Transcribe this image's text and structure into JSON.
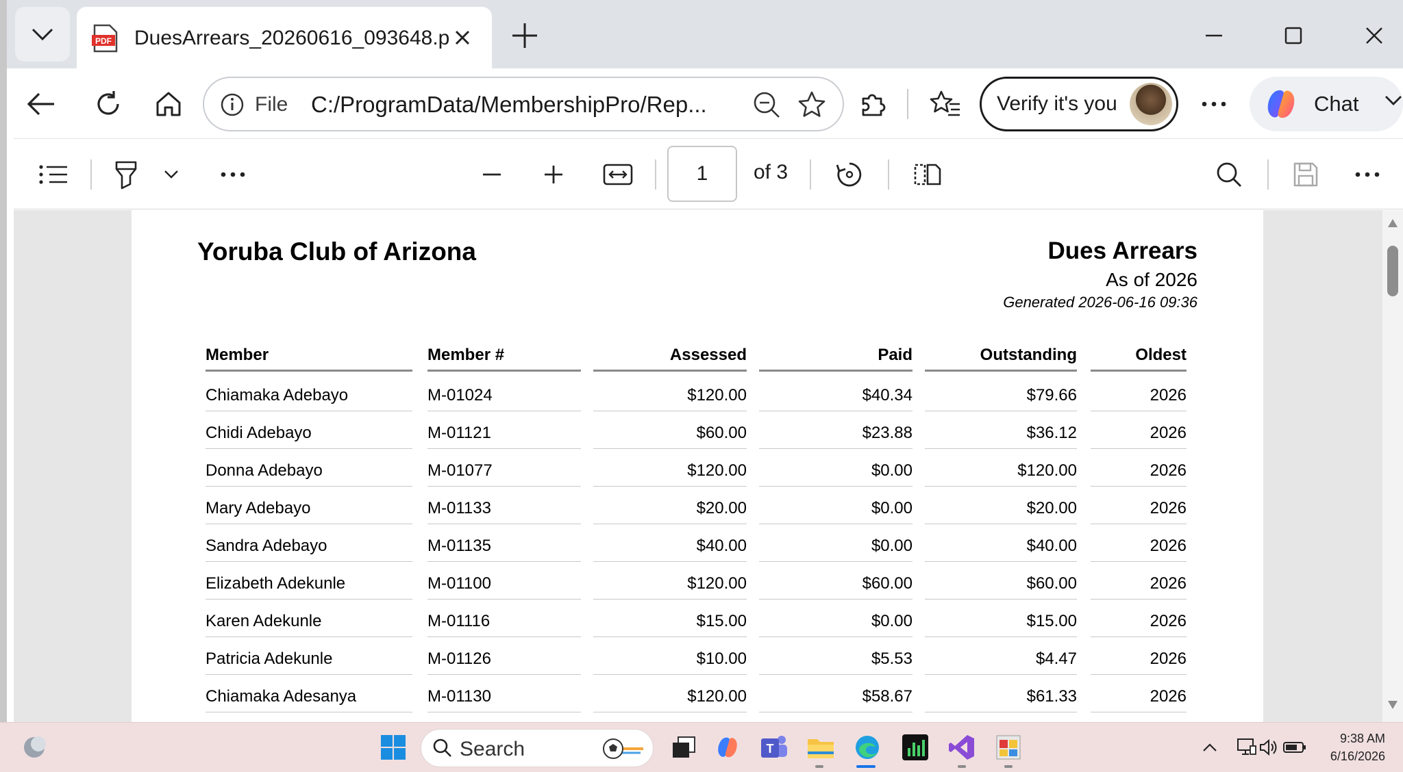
{
  "browser": {
    "tab_title": "DuesArrears_20260616_093648.pdf",
    "omnibox_prefix": "File",
    "url": "C:/ProgramData/MembershipPro/Rep...",
    "verify_label": "Verify it's you",
    "copilot_label": "Chat"
  },
  "pdf_toolbar": {
    "page_current": "1",
    "page_total_label": "of 3"
  },
  "report": {
    "organization": "Yoruba Club of Arizona",
    "title": "Dues Arrears",
    "as_of": "As of 2026",
    "generated": "Generated 2026-06-16 09:36",
    "columns": [
      "Member",
      "Member #",
      "Assessed",
      "Paid",
      "Outstanding",
      "Oldest"
    ],
    "rows": [
      [
        "Chiamaka Adebayo",
        "M-01024",
        "$120.00",
        "$40.34",
        "$79.66",
        "2026"
      ],
      [
        "Chidi Adebayo",
        "M-01121",
        "$60.00",
        "$23.88",
        "$36.12",
        "2026"
      ],
      [
        "Donna Adebayo",
        "M-01077",
        "$120.00",
        "$0.00",
        "$120.00",
        "2026"
      ],
      [
        "Mary Adebayo",
        "M-01133",
        "$20.00",
        "$0.00",
        "$20.00",
        "2026"
      ],
      [
        "Sandra Adebayo",
        "M-01135",
        "$40.00",
        "$0.00",
        "$40.00",
        "2026"
      ],
      [
        "Elizabeth Adekunle",
        "M-01100",
        "$120.00",
        "$60.00",
        "$60.00",
        "2026"
      ],
      [
        "Karen Adekunle",
        "M-01116",
        "$15.00",
        "$0.00",
        "$15.00",
        "2026"
      ],
      [
        "Patricia Adekunle",
        "M-01126",
        "$10.00",
        "$5.53",
        "$4.47",
        "2026"
      ],
      [
        "Chiamaka Adesanya",
        "M-01130",
        "$120.00",
        "$58.67",
        "$61.33",
        "2026"
      ]
    ]
  },
  "taskbar": {
    "search_label": "Search",
    "time": "9:38 AM",
    "date": "6/16/2026"
  }
}
